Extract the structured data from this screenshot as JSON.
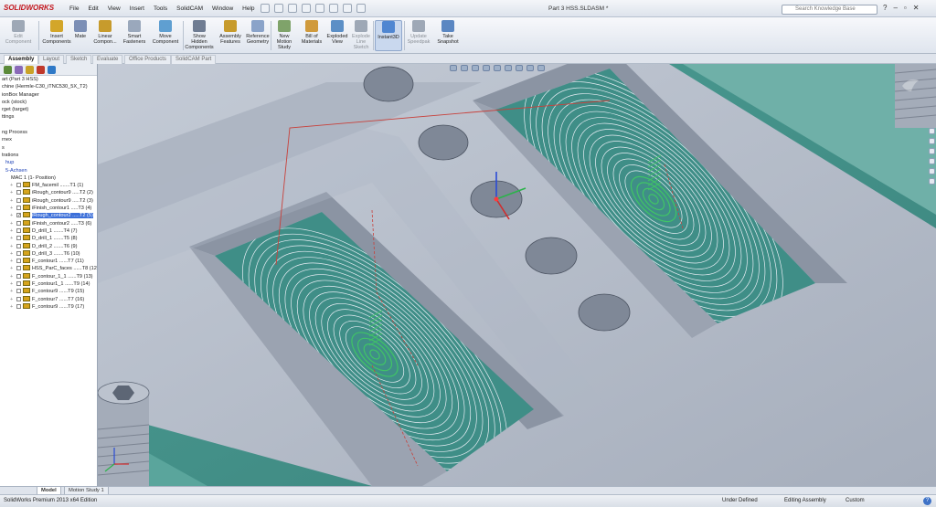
{
  "app": {
    "brand": "SOLIDWORKS",
    "document_title": "Part 3 HSS.SLDASM *"
  },
  "menus": [
    "File",
    "Edit",
    "View",
    "Insert",
    "Tools",
    "SolidCAM",
    "Window",
    "Help"
  ],
  "search": {
    "placeholder": "Search Knowledge Base"
  },
  "ribbon": {
    "buttons": [
      {
        "label": "Edit\nComponent",
        "icon": "edit-component-icon",
        "enabled": false
      },
      {
        "label": "Insert\nComponents",
        "icon": "insert-components-icon",
        "enabled": true
      },
      {
        "label": "Mate",
        "icon": "mate-icon",
        "enabled": true
      },
      {
        "label": "Linear\nCompon...",
        "icon": "linear-pattern-icon",
        "enabled": true
      },
      {
        "label": "Smart\nFasteners",
        "icon": "smart-fasteners-icon",
        "enabled": true
      },
      {
        "label": "Move\nComponent",
        "icon": "move-component-icon",
        "enabled": true
      },
      {
        "label": "Show\nHidden\nComponents",
        "icon": "show-hidden-icon",
        "enabled": true
      },
      {
        "label": "Assembly\nFeatures",
        "icon": "assembly-features-icon",
        "enabled": true
      },
      {
        "label": "Reference\nGeometry",
        "icon": "reference-geometry-icon",
        "enabled": true
      },
      {
        "label": "New\nMotion\nStudy",
        "icon": "motion-study-icon",
        "enabled": true
      },
      {
        "label": "Bill of\nMaterials",
        "icon": "bom-icon",
        "enabled": true
      },
      {
        "label": "Exploded\nView",
        "icon": "exploded-view-icon",
        "enabled": true
      },
      {
        "label": "Explode\nLine\nSketch",
        "icon": "explode-line-icon",
        "enabled": false
      },
      {
        "label": "Instant3D",
        "icon": "instant3d-icon",
        "enabled": true,
        "active": true
      },
      {
        "label": "Update\nSpeedpak",
        "icon": "speedpak-icon",
        "enabled": false
      },
      {
        "label": "Take\nSnapshot",
        "icon": "snapshot-icon",
        "enabled": true
      }
    ]
  },
  "tabs": [
    "Assembly",
    "Layout",
    "Sketch",
    "Evaluate",
    "Office Products",
    "SolidCAM Part"
  ],
  "active_tab": "Assembly",
  "feature_tree": {
    "items": [
      {
        "label": "art (Part 3 HSS)",
        "style": "plain"
      },
      {
        "label": "chine (Hermle-C30_iTNC530_5X_T2)",
        "style": "plain"
      },
      {
        "label": "ionBox Manager",
        "style": "plain"
      },
      {
        "label": "ock (stock)",
        "style": "plain"
      },
      {
        "label": "rget (target)",
        "style": "plain"
      },
      {
        "label": "ttings",
        "style": "plain"
      },
      {
        "label": "",
        "style": "plain"
      },
      {
        "label": "ng Process",
        "style": "plain"
      },
      {
        "label": "rnex",
        "style": "plain"
      },
      {
        "label": "s",
        "style": "plain"
      },
      {
        "label": "trations",
        "style": "plain"
      },
      {
        "label": "hup",
        "style": "blue"
      },
      {
        "label": "5-Achsen",
        "style": "blue"
      },
      {
        "label": "MAC 1 (1- Position)",
        "style": "plain"
      },
      {
        "label": "FM_facemil .......T1 (1)",
        "style": "op"
      },
      {
        "label": "iRough_contour9 .....T2 (2)",
        "style": "op"
      },
      {
        "label": "iRough_contour9 .....T2 (3)",
        "style": "op"
      },
      {
        "label": "iFinish_contour1 .....T3 (4)",
        "style": "op"
      },
      {
        "label": "iRough_contour2 .....T2 (5)",
        "style": "op-selected"
      },
      {
        "label": "iFinish_contour2 .....T3 (6)",
        "style": "op"
      },
      {
        "label": "D_drill_1 .......T4 (7)",
        "style": "op"
      },
      {
        "label": "D_drill_1 .......T5 (8)",
        "style": "op"
      },
      {
        "label": "D_drill_2 .......T6 (9)",
        "style": "op"
      },
      {
        "label": "D_drill_3 .......T6 (10)",
        "style": "op"
      },
      {
        "label": "F_contour1 ......T7 (11)",
        "style": "op"
      },
      {
        "label": "HSS_ParC_faces ......T8 (12)",
        "style": "op"
      },
      {
        "label": "F_contour_1_1 ......T9 (13)",
        "style": "op"
      },
      {
        "label": "F_contour1_1 ......T9 (14)",
        "style": "op"
      },
      {
        "label": "F_contour9 ......T9 (15)",
        "style": "op"
      },
      {
        "label": "F_contour7 ......T7 (16)",
        "style": "op"
      },
      {
        "label": "F_contour9 ......T9 (17)",
        "style": "op"
      }
    ]
  },
  "bottom_tabs": [
    "Model",
    "Motion Study 1"
  ],
  "status": {
    "edition": "SolidWorks Premium 2013 x64 Edition",
    "definition": "Under Defined",
    "mode": "Editing Assembly",
    "units": "Custom",
    "help": "?"
  },
  "colors": {
    "part_face": "#b4bcc9",
    "cutaway_background": "#4f9a93",
    "toolpath_rough": "#e8eef5",
    "toolpath_red": "#c8413b",
    "toolpath_green": "#40c466",
    "selection_blue": "#3c6fd9"
  }
}
